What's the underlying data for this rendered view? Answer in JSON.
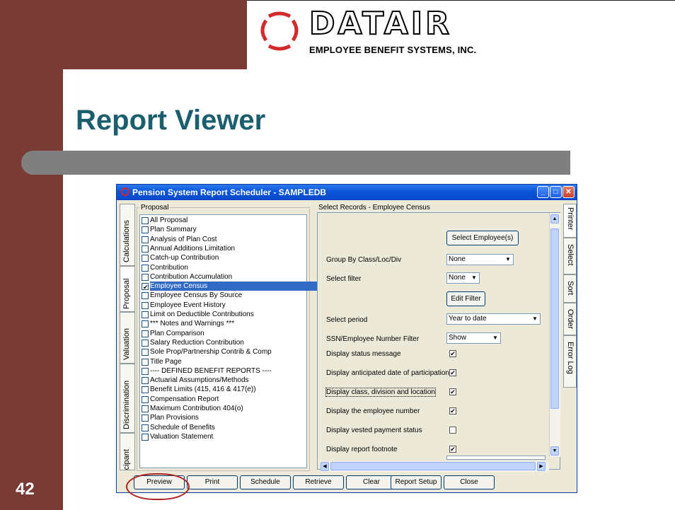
{
  "slide": {
    "title": "Report Viewer",
    "number": "42",
    "logo_word": "DATAIR",
    "logo_subtitle": "EMPLOYEE BENEFIT SYSTEMS, INC.",
    "colors": {
      "band": "#7a3b35",
      "title": "#1b5e6e",
      "bar": "#7f7f7f"
    }
  },
  "window": {
    "title": "Pension System Report Scheduler - SAMPLEDB",
    "left_tabs": [
      "Calculations",
      "Proposal",
      "Valuation",
      "Discrimination",
      "Participant"
    ],
    "right_tabs": [
      "Printer",
      "Select",
      "Sort",
      "Order",
      "Error Log"
    ],
    "proposal": {
      "label": "Proposal",
      "items": [
        "All Proposal",
        "Plan Summary",
        "Analysis of Plan Cost",
        "Annual Additions Limitation",
        "Catch-up Contribution",
        "Contribution",
        "Contribution Accumulation",
        "Employee Census",
        "Employee Census By Source",
        "Employee Event History",
        "Limit on Deductible Contributions",
        "*** Notes and Warnings ***",
        "Plan Comparison",
        "Salary Reduction Contribution",
        "Sole Prop/Partnership Contrib & Comp",
        "Title Page",
        "---- DEFINED BENEFIT REPORTS ----",
        "Actuarial Assumptions/Methods",
        "Benefit Limits (415, 416 & 417(e))",
        "Compensation Report",
        "Maximum Contribution 404(o)",
        "Plan Provisions",
        "Schedule of Benefits",
        "Valuation Statement"
      ],
      "selected": "Employee Census"
    },
    "records": {
      "label": "Select Records - Employee Census",
      "select_employees_btn": "Select Employee(s)",
      "group_by_label": "Group By Class/Loc/Div",
      "group_by_value": "None",
      "select_filter_label": "Select filter",
      "select_filter_value": "None",
      "edit_filter_btn": "Edit Filter",
      "select_period_label": "Select period",
      "select_period_value": "Year to date",
      "ssn_filter_label": "SSN/Employee Number Filter",
      "ssn_filter_value": "Show",
      "options": [
        {
          "label": "Display status message",
          "checked": "✔"
        },
        {
          "label": "Display anticipated date of participation",
          "checked": "✔"
        },
        {
          "label": "Display class, division and location",
          "checked": "✔"
        },
        {
          "label": "Display the employee number",
          "checked": "✔"
        },
        {
          "label": "Display vested payment status",
          "checked": ""
        },
        {
          "label": "Display report footnote",
          "checked": "✔"
        }
      ]
    },
    "buttons": [
      "Preview",
      "Print",
      "Schedule",
      "Retrieve",
      "Clear",
      "Report Setup",
      "Close"
    ]
  }
}
